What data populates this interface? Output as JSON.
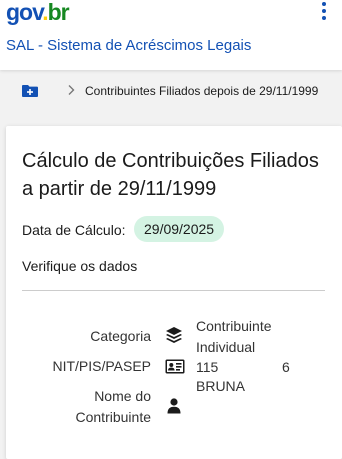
{
  "header": {
    "logo": {
      "part1": "gov",
      "part2": ".",
      "part3": "br"
    },
    "system_title": "SAL - Sistema de Acréscimos Legais",
    "menu_icon": "kebab-menu-icon"
  },
  "breadcrumb": {
    "home_icon": "folder-plus-icon",
    "separator_icon": "chevron-right-icon",
    "current": "Contribuintes Filiados depois de 29/11/1999"
  },
  "card": {
    "title": "Cálculo de Contribuições Filiados a partir de 29/11/1999",
    "date_label": "Data de Cálculo:",
    "date_value": "29/09/2025",
    "verify_text": "Verifique os dados",
    "fields": {
      "categoria": {
        "label": "Categoria",
        "icon": "layers-icon",
        "value_line1": "Contribuinte",
        "value_line2": "Individual"
      },
      "nit": {
        "label": "NIT/PIS/PASEP",
        "icon": "id-card-icon",
        "value_part1": "115",
        "value_part2": "6"
      },
      "nome": {
        "label_line1": "Nome do",
        "label_line2": "Contribuinte",
        "icon": "user-icon",
        "value": "BRUNA"
      }
    }
  },
  "colors": {
    "primary_blue": "#1351b4",
    "badge_green": "#d4f3e3",
    "logo_yellow": "#ffcd07",
    "logo_green": "#168821"
  }
}
